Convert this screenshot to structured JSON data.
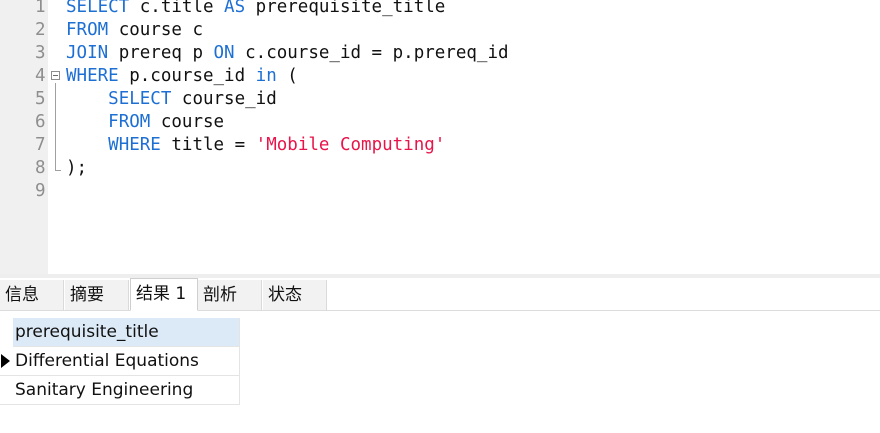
{
  "editor": {
    "lines": [
      {
        "n": "1",
        "tokens": [
          [
            "kw",
            "SELECT"
          ],
          [
            "t",
            " c.title "
          ],
          [
            "kw",
            "AS"
          ],
          [
            "t",
            " prerequisite_title"
          ]
        ]
      },
      {
        "n": "2",
        "tokens": [
          [
            "kw",
            "FROM"
          ],
          [
            "t",
            " course c"
          ]
        ]
      },
      {
        "n": "3",
        "tokens": [
          [
            "kw",
            "JOIN"
          ],
          [
            "t",
            " prereq p "
          ],
          [
            "kw",
            "ON"
          ],
          [
            "t",
            " c.course_id = p.prereq_id"
          ]
        ]
      },
      {
        "n": "4",
        "tokens": [
          [
            "kw",
            "WHERE"
          ],
          [
            "t",
            " p.course_id "
          ],
          [
            "kw",
            "in"
          ],
          [
            "t",
            " ("
          ]
        ]
      },
      {
        "n": "5",
        "tokens": [
          [
            "t",
            "    "
          ],
          [
            "kw",
            "SELECT"
          ],
          [
            "t",
            " course_id"
          ]
        ]
      },
      {
        "n": "6",
        "tokens": [
          [
            "t",
            "    "
          ],
          [
            "kw",
            "FROM"
          ],
          [
            "t",
            " course"
          ]
        ]
      },
      {
        "n": "7",
        "tokens": [
          [
            "t",
            "    "
          ],
          [
            "kw",
            "WHERE"
          ],
          [
            "t",
            " title = "
          ],
          [
            "str",
            "'Mobile Computing'"
          ]
        ]
      },
      {
        "n": "8",
        "tokens": [
          [
            "t",
            ");"
          ]
        ]
      },
      {
        "n": "9",
        "tokens": []
      }
    ]
  },
  "tabs": [
    {
      "id": "info",
      "label": "信息",
      "active": false
    },
    {
      "id": "summary",
      "label": "摘要",
      "active": false
    },
    {
      "id": "result1",
      "label": "结果 1",
      "active": true
    },
    {
      "id": "profile",
      "label": "剖析",
      "active": false
    },
    {
      "id": "status",
      "label": "状态",
      "active": false
    }
  ],
  "results": {
    "columns": [
      "prerequisite_title"
    ],
    "rows": [
      [
        "Differential Equations"
      ],
      [
        "Sanitary Engineering"
      ]
    ],
    "current_row": 0
  }
}
